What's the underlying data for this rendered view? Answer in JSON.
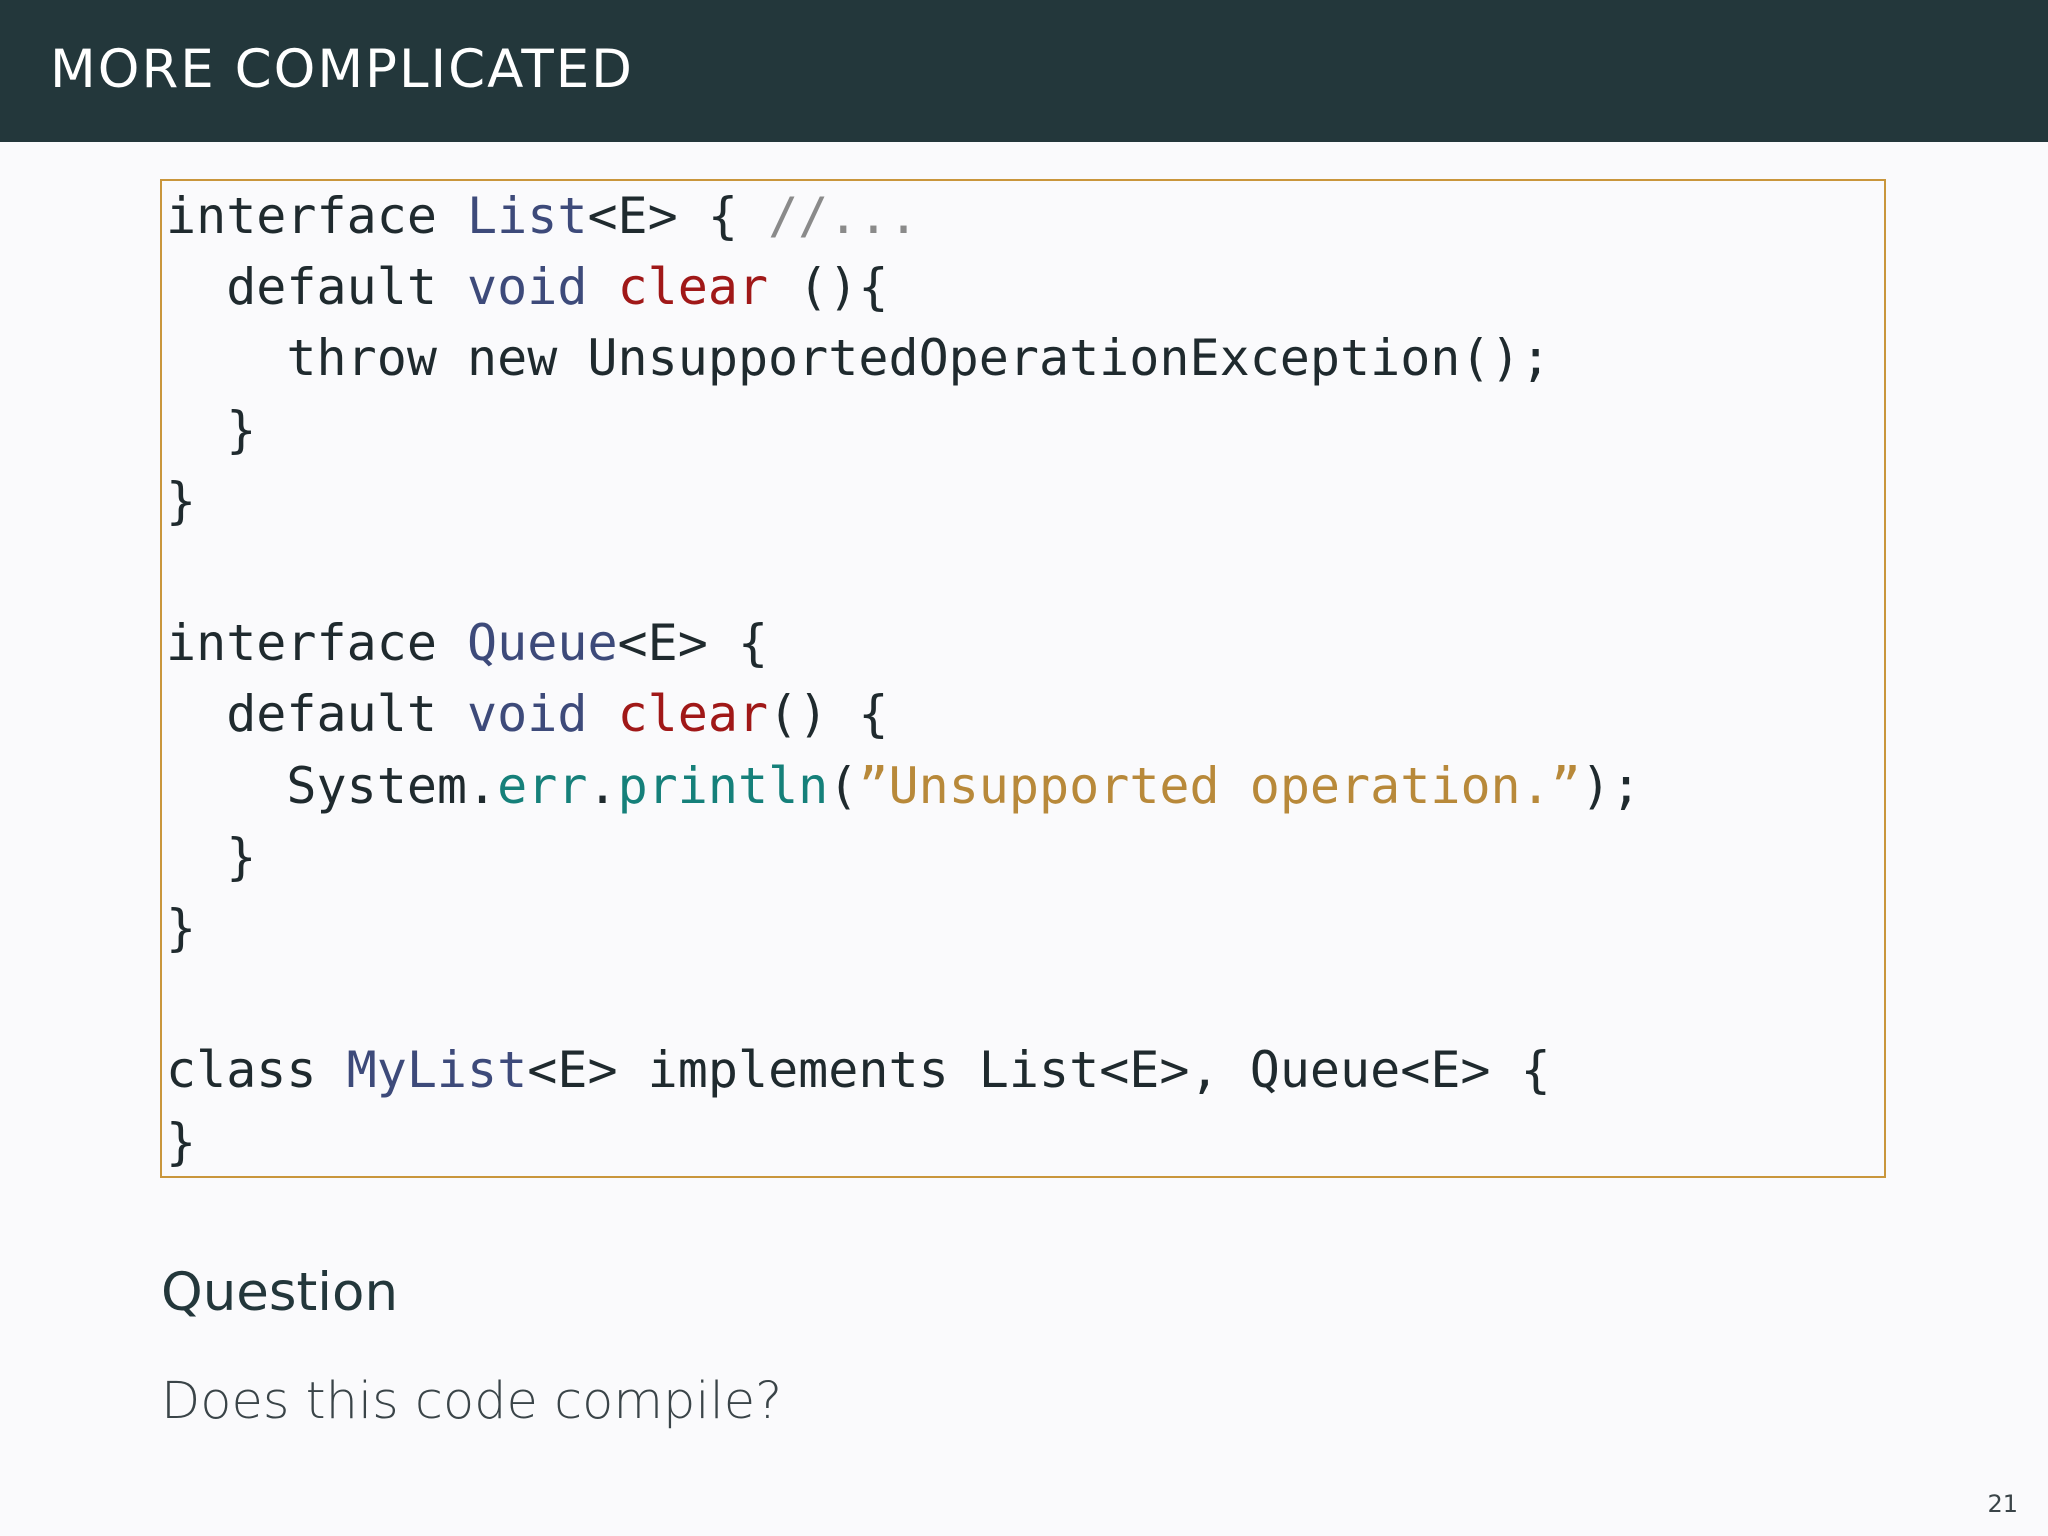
{
  "slide": {
    "title": "MORE COMPLICATED",
    "page_number": "21"
  },
  "code": {
    "lines": [
      [
        {
          "text": "interface ",
          "style": "plain"
        },
        {
          "text": "List",
          "style": "type"
        },
        {
          "text": "<E> { ",
          "style": "plain"
        },
        {
          "text": "//...",
          "style": "comment"
        }
      ],
      [
        {
          "text": "  default ",
          "style": "plain"
        },
        {
          "text": "void",
          "style": "type"
        },
        {
          "text": " ",
          "style": "plain"
        },
        {
          "text": "clear",
          "style": "red"
        },
        {
          "text": " (){",
          "style": "plain"
        }
      ],
      [
        {
          "text": "    throw new UnsupportedOperationException();",
          "style": "plain"
        }
      ],
      [
        {
          "text": "  }",
          "style": "plain"
        }
      ],
      [
        {
          "text": "}",
          "style": "plain"
        }
      ],
      [],
      [
        {
          "text": "interface ",
          "style": "plain"
        },
        {
          "text": "Queue",
          "style": "type"
        },
        {
          "text": "<E> {",
          "style": "plain"
        }
      ],
      [
        {
          "text": "  default ",
          "style": "plain"
        },
        {
          "text": "void",
          "style": "type"
        },
        {
          "text": " ",
          "style": "plain"
        },
        {
          "text": "clear",
          "style": "red"
        },
        {
          "text": "() {",
          "style": "plain"
        }
      ],
      [
        {
          "text": "    System.",
          "style": "plain"
        },
        {
          "text": "err",
          "style": "teal"
        },
        {
          "text": ".",
          "style": "plain"
        },
        {
          "text": "println",
          "style": "teal"
        },
        {
          "text": "(",
          "style": "plain"
        },
        {
          "text": "”Unsupported operation.”",
          "style": "string"
        },
        {
          "text": ");",
          "style": "plain"
        }
      ],
      [
        {
          "text": "  }",
          "style": "plain"
        }
      ],
      [
        {
          "text": "}",
          "style": "plain"
        }
      ],
      [],
      [
        {
          "text": "class ",
          "style": "plain"
        },
        {
          "text": "MyList",
          "style": "type"
        },
        {
          "text": "<E> implements List<E>, Queue<E> {",
          "style": "plain"
        }
      ],
      [
        {
          "text": "}",
          "style": "plain"
        }
      ]
    ]
  },
  "question": {
    "heading": "Question",
    "text": "Does this code compile?"
  },
  "colors": {
    "title_bar": "#23373b",
    "code_border": "#c9963c",
    "keyword_type": "#3d4a7a",
    "keyword_red": "#a01818",
    "keyword_teal": "#15807a",
    "string": "#b8893a",
    "comment": "#8a8a8a"
  }
}
